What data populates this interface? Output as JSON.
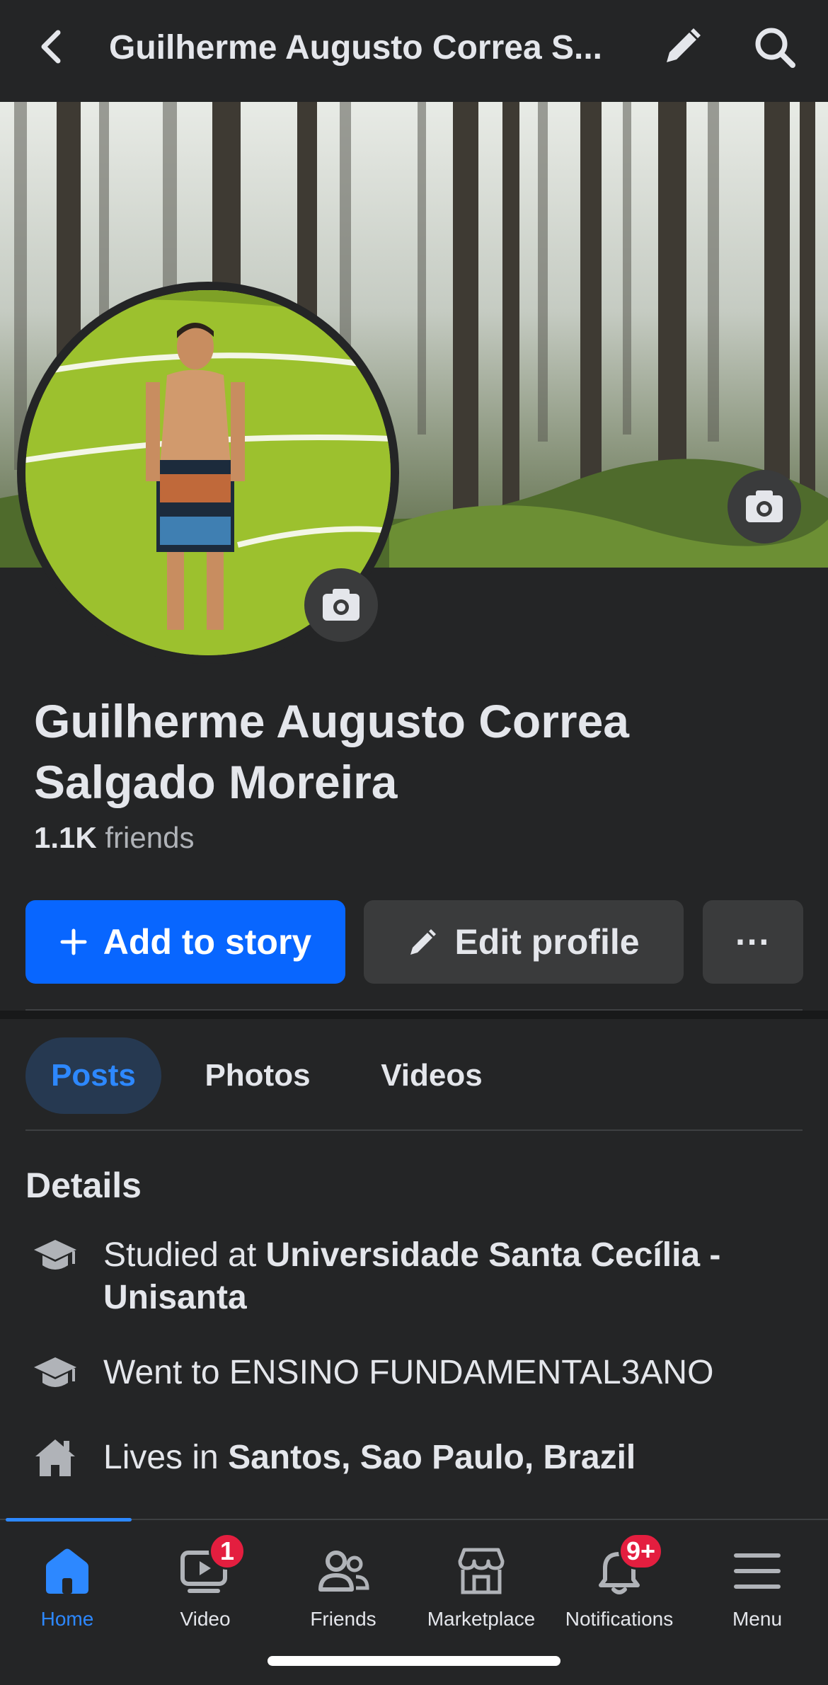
{
  "header": {
    "title": "Guilherme Augusto Correa S..."
  },
  "profile": {
    "name": "Guilherme Augusto Correa Salgado Moreira",
    "friends_count": "1.1K",
    "friends_label": "friends"
  },
  "actions": {
    "add_story": "Add to story",
    "edit_profile": "Edit profile",
    "more": "···"
  },
  "tabs": [
    {
      "label": "Posts",
      "active": true
    },
    {
      "label": "Photos",
      "active": false
    },
    {
      "label": "Videos",
      "active": false
    }
  ],
  "details": {
    "heading": "Details",
    "items": [
      {
        "icon": "graduation-cap-icon",
        "prefix": "Studied at ",
        "value": "Universidade Santa Cecília - Unisanta"
      },
      {
        "icon": "graduation-cap-icon",
        "prefix": "Went to ENSINO FUNDAMENTAL3ANO",
        "value": ""
      },
      {
        "icon": "home-icon",
        "prefix": "Lives in ",
        "value": "Santos, Sao Paulo, Brazil"
      }
    ]
  },
  "bottom_nav": [
    {
      "label": "Home",
      "icon": "home-icon",
      "active": true,
      "badge": ""
    },
    {
      "label": "Video",
      "icon": "video-icon",
      "active": false,
      "badge": "1"
    },
    {
      "label": "Friends",
      "icon": "friends-icon",
      "active": false,
      "badge": ""
    },
    {
      "label": "Marketplace",
      "icon": "marketplace-icon",
      "active": false,
      "badge": ""
    },
    {
      "label": "Notifications",
      "icon": "bell-icon",
      "active": false,
      "badge": "9+"
    },
    {
      "label": "Menu",
      "icon": "menu-icon",
      "active": false,
      "badge": ""
    }
  ],
  "colors": {
    "background": "#242526",
    "accent": "#0866ff",
    "active_tab_bg": "#263951",
    "active_text": "#2d88ff",
    "badge": "#e41e3f"
  }
}
